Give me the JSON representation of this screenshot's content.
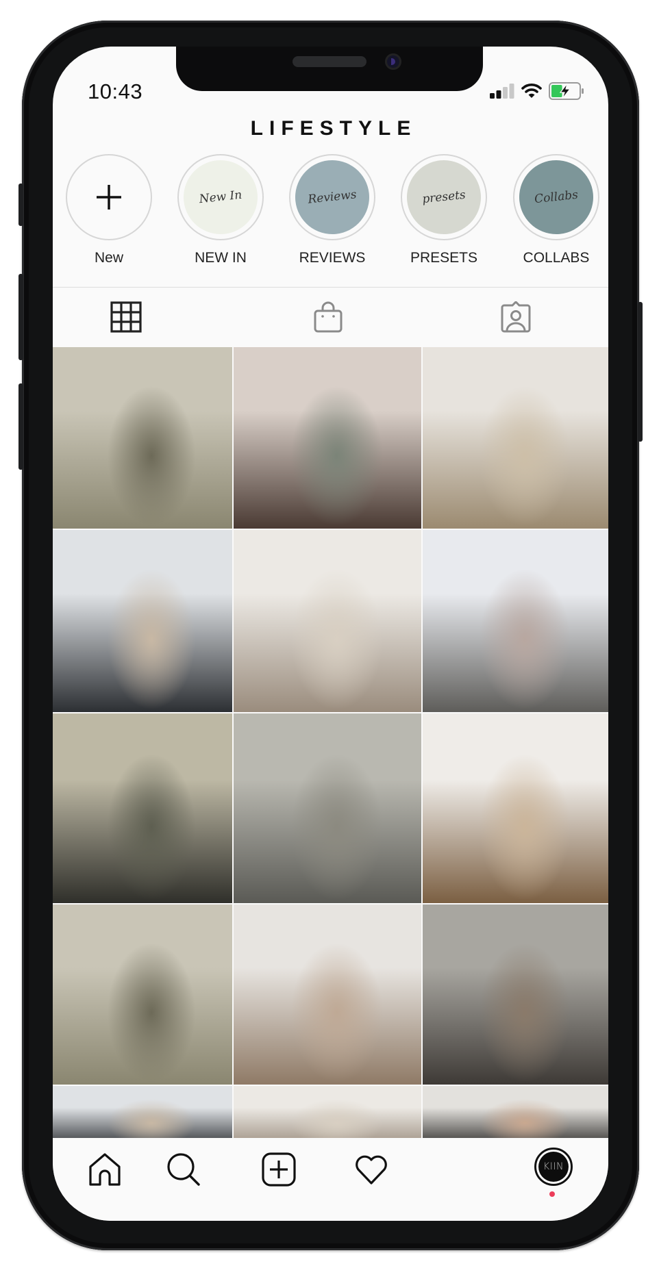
{
  "status_bar": {
    "time": "10:43",
    "signal_icon": "cellular-signal-icon",
    "signal_bars_active": 2,
    "signal_bars_total": 4,
    "wifi_icon": "wifi-icon",
    "battery_icon": "battery-charging-icon",
    "battery_level": 0.4,
    "battery_color": "#34c759"
  },
  "header": {
    "title": "LIFESTYLE"
  },
  "highlights": [
    {
      "label": "New",
      "kind": "new",
      "icon": "plus-icon",
      "cover_text": ""
    },
    {
      "label": "NEW IN",
      "kind": "highlight",
      "cover_text": "New In",
      "cover_color": "#eef1e8"
    },
    {
      "label": "REVIEWS",
      "kind": "highlight",
      "cover_text": "Reviews",
      "cover_color": "#9aaeb5"
    },
    {
      "label": "PRESETS",
      "kind": "highlight",
      "cover_text": "presets",
      "cover_color": "#d6d8d0"
    },
    {
      "label": "COLLABS",
      "kind": "highlight",
      "cover_text": "Collabs",
      "cover_color": "#7d9699"
    }
  ],
  "profile_tabs": [
    {
      "name": "posts-grid",
      "icon": "grid-icon",
      "active": true
    },
    {
      "name": "shop",
      "icon": "shopping-bag-icon",
      "active": false
    },
    {
      "name": "tagged",
      "icon": "tagged-user-icon",
      "active": false
    }
  ],
  "posts": [
    {
      "subject": "couple embracing in palm grove",
      "tone": [
        "#c9c5b6",
        "#6d6a58",
        "#8a8670"
      ]
    },
    {
      "subject": "woman in sunglasses at iron gate",
      "tone": [
        "#d9cfc8",
        "#7b8478",
        "#4a3a33"
      ]
    },
    {
      "subject": "plate of pasta on table",
      "tone": [
        "#e7e3dd",
        "#cdbfa8",
        "#9b8a70"
      ]
    },
    {
      "subject": "couple kissing outdoors",
      "tone": [
        "#dfe2e5",
        "#c8b8a4",
        "#2c2f33"
      ]
    },
    {
      "subject": "blonde woman in white shirt by door",
      "tone": [
        "#ece9e4",
        "#d8cfc2",
        "#9a8c7d"
      ]
    },
    {
      "subject": "woman posing against white wall",
      "tone": [
        "#e8eaee",
        "#b8a7a0",
        "#5e5d5a"
      ]
    },
    {
      "subject": "palm leaves close up",
      "tone": [
        "#bdb8a4",
        "#5e5f51",
        "#2f2f2a"
      ]
    },
    {
      "subject": "woman in trench coat with camera",
      "tone": [
        "#b9b8b0",
        "#8c8a80",
        "#5a5a55"
      ]
    },
    {
      "subject": "white knit cardigan with chain handbag",
      "tone": [
        "#efece8",
        "#cbb59a",
        "#7b5f42"
      ]
    },
    {
      "subject": "couple embracing in palm grove",
      "tone": [
        "#c9c5b6",
        "#6d6a58",
        "#8a8670"
      ]
    },
    {
      "subject": "woman in satin slip dress",
      "tone": [
        "#e7e4e0",
        "#bfa995",
        "#8f7a66"
      ]
    },
    {
      "subject": "coffee cups on cafe table",
      "tone": [
        "#a8a6a0",
        "#8a7a6a",
        "#3e3a36"
      ]
    },
    {
      "subject": "couple kissing outdoors",
      "tone": [
        "#dfe2e5",
        "#c8b8a4",
        "#2c2f33"
      ]
    },
    {
      "subject": "blonde woman in white shirt by door",
      "tone": [
        "#ece9e4",
        "#d8cfc2",
        "#9a8c7d"
      ]
    },
    {
      "subject": "woman in sunglasses",
      "tone": [
        "#e3e1dd",
        "#c9a890",
        "#2c2a28"
      ]
    }
  ],
  "bottom_nav": [
    {
      "name": "home",
      "icon": "home-icon"
    },
    {
      "name": "search",
      "icon": "search-icon"
    },
    {
      "name": "create",
      "icon": "add-post-icon"
    },
    {
      "name": "activity",
      "icon": "heart-icon"
    },
    {
      "name": "profile",
      "icon": "avatar",
      "avatar_text": "KIIN",
      "notification_dot_color": "#ec3d5a"
    }
  ]
}
